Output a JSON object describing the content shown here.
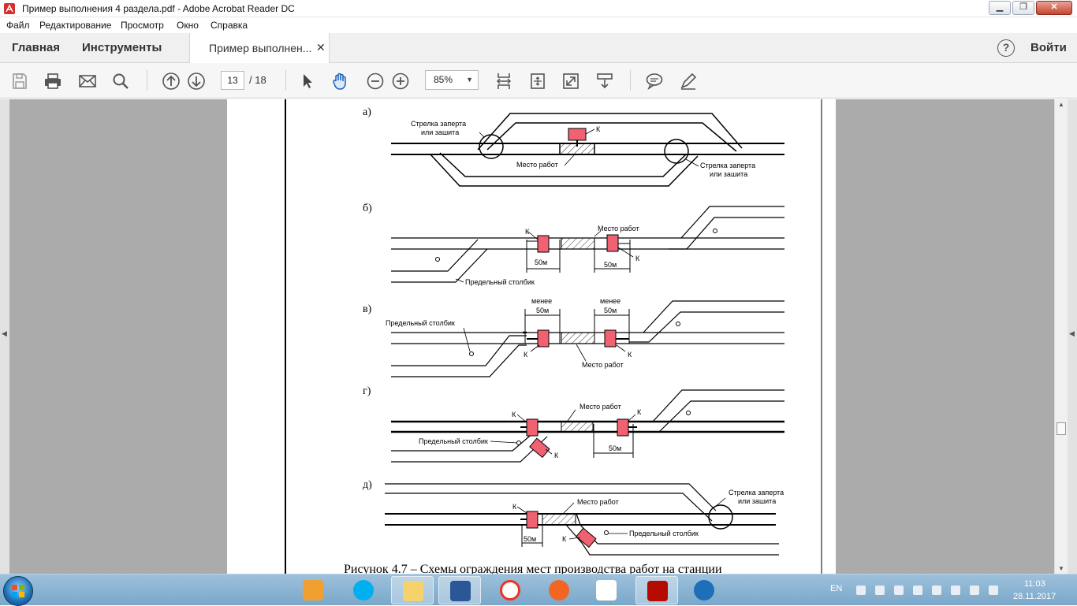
{
  "window": {
    "title": "Пример выполнения 4 раздела.pdf - Adobe Acrobat Reader DC",
    "minimize": "▁",
    "maximize": "❐",
    "close": "✕"
  },
  "menu": [
    "Файл",
    "Редактирование",
    "Просмотр",
    "Окно",
    "Справка"
  ],
  "tabs": {
    "home": "Главная",
    "tools": "Инструменты",
    "document": "Пример выполнен...",
    "document_close": "✕"
  },
  "header": {
    "help": "?",
    "signin": "Войти"
  },
  "toolbar": {
    "page_current": "13",
    "page_total": "/ 18",
    "zoom": "85%"
  },
  "figure": {
    "a": {
      "label": "а)",
      "strelka_left_1": "Стрелка заперта",
      "strelka_left_2": "или зашита",
      "k": "К",
      "mesto": "Место работ",
      "strelka_right_1": "Стрелка заперта",
      "strelka_right_2": "или зашита"
    },
    "b": {
      "label": "б)",
      "k1": "К",
      "mesto": "Место работ",
      "dist1": "50м",
      "dist2": "50м",
      "k2": "К",
      "stolbik": "Предельный столбик"
    },
    "v": {
      "label": "в)",
      "menee1": "менее",
      "dist1": "50м",
      "menee2": "менее",
      "dist2": "50м",
      "stolbik": "Предельный столбик",
      "k1": "К",
      "k2": "К",
      "mesto": "Место работ"
    },
    "g": {
      "label": "г)",
      "k1": "К",
      "mesto": "Место работ",
      "k2": "К",
      "stolbik": "Предельный столбик",
      "k3": "К",
      "dist": "50м"
    },
    "d": {
      "label": "д)",
      "k1": "К",
      "mesto": "Место работ",
      "strelka_1": "Стрелка заперта",
      "strelka_2": "или зашита",
      "dist": "50м",
      "k2": "К",
      "stolbik": "Предельный столбик"
    },
    "caption": "Рисунок 4.7 – Схемы ограждения мест производства работ на станции"
  },
  "taskbar": {
    "lang": "EN",
    "time": "11:03",
    "date": "28.11.2017"
  },
  "colors": {
    "signal": "#f06272",
    "page_bg": "#ababab"
  }
}
